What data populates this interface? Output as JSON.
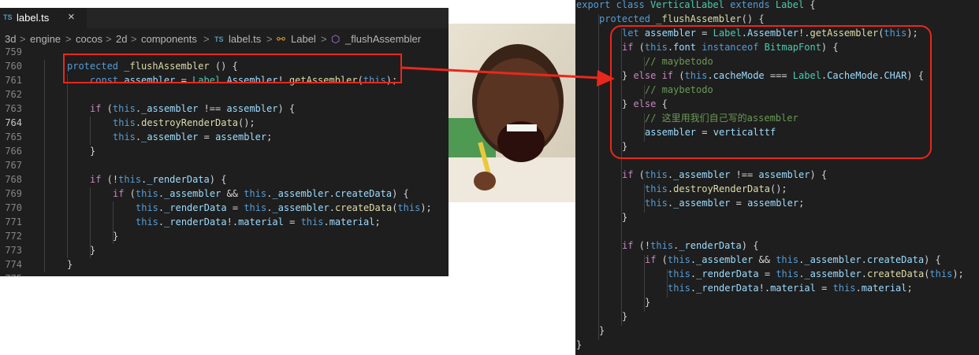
{
  "left_editor": {
    "tab": {
      "lang": "TS",
      "title": "label.ts",
      "close": "×"
    },
    "breadcrumb": {
      "items": [
        "3d",
        "engine",
        "cocos",
        "2d",
        "components"
      ],
      "file_lang": "TS",
      "file": "label.ts",
      "class_name": "Label",
      "method_name": "_flushAssembler",
      "separator": ">"
    },
    "lines": [
      {
        "n": "759",
        "tokens": []
      },
      {
        "n": "760",
        "tokens": [
          [
            "kw",
            "protected"
          ],
          [
            "txt",
            " "
          ],
          [
            "fn",
            "_flushAssembler"
          ],
          [
            "txt",
            " () {"
          ]
        ]
      },
      {
        "n": "761",
        "tokens": [
          [
            "kw",
            "const"
          ],
          [
            "txt",
            " "
          ],
          [
            "var",
            "assembler"
          ],
          [
            "txt",
            " = "
          ],
          [
            "cls",
            "Label"
          ],
          [
            "txt",
            "."
          ],
          [
            "var",
            "Assembler"
          ],
          [
            "txt",
            "!."
          ],
          [
            "fn",
            "getAssembler"
          ],
          [
            "txt",
            "("
          ],
          [
            "kw",
            "this"
          ],
          [
            "txt",
            ");"
          ]
        ]
      },
      {
        "n": "762",
        "tokens": []
      },
      {
        "n": "763",
        "tokens": [
          [
            "ctl",
            "if"
          ],
          [
            "txt",
            " ("
          ],
          [
            "kw",
            "this"
          ],
          [
            "txt",
            "."
          ],
          [
            "var",
            "_assembler"
          ],
          [
            "txt",
            " !== "
          ],
          [
            "var",
            "assembler"
          ],
          [
            "txt",
            ") {"
          ]
        ]
      },
      {
        "n": "764",
        "tokens": [
          [
            "kw",
            "this"
          ],
          [
            "txt",
            "."
          ],
          [
            "fn",
            "destroyRenderData"
          ],
          [
            "txt",
            "();"
          ]
        ]
      },
      {
        "n": "765",
        "tokens": [
          [
            "kw",
            "this"
          ],
          [
            "txt",
            "."
          ],
          [
            "var",
            "_assembler"
          ],
          [
            "txt",
            " = "
          ],
          [
            "var",
            "assembler"
          ],
          [
            "txt",
            ";"
          ]
        ]
      },
      {
        "n": "766",
        "tokens": [
          [
            "txt",
            "}"
          ]
        ]
      },
      {
        "n": "767",
        "tokens": []
      },
      {
        "n": "768",
        "tokens": [
          [
            "ctl",
            "if"
          ],
          [
            "txt",
            " (!"
          ],
          [
            "kw",
            "this"
          ],
          [
            "txt",
            "."
          ],
          [
            "var",
            "_renderData"
          ],
          [
            "txt",
            ") {"
          ]
        ]
      },
      {
        "n": "769",
        "tokens": [
          [
            "ctl",
            "if"
          ],
          [
            "txt",
            " ("
          ],
          [
            "kw",
            "this"
          ],
          [
            "txt",
            "."
          ],
          [
            "var",
            "_assembler"
          ],
          [
            "txt",
            " && "
          ],
          [
            "kw",
            "this"
          ],
          [
            "txt",
            "."
          ],
          [
            "var",
            "_assembler"
          ],
          [
            "txt",
            "."
          ],
          [
            "var",
            "createData"
          ],
          [
            "txt",
            ") {"
          ]
        ]
      },
      {
        "n": "770",
        "tokens": [
          [
            "kw",
            "this"
          ],
          [
            "txt",
            "."
          ],
          [
            "var",
            "_renderData"
          ],
          [
            "txt",
            " = "
          ],
          [
            "kw",
            "this"
          ],
          [
            "txt",
            "."
          ],
          [
            "var",
            "_assembler"
          ],
          [
            "txt",
            "."
          ],
          [
            "fn",
            "createData"
          ],
          [
            "txt",
            "("
          ],
          [
            "kw",
            "this"
          ],
          [
            "txt",
            ");"
          ]
        ]
      },
      {
        "n": "771",
        "tokens": [
          [
            "kw",
            "this"
          ],
          [
            "txt",
            "."
          ],
          [
            "var",
            "_renderData"
          ],
          [
            "txt",
            "!."
          ],
          [
            "var",
            "material"
          ],
          [
            "txt",
            " = "
          ],
          [
            "kw",
            "this"
          ],
          [
            "txt",
            "."
          ],
          [
            "var",
            "material"
          ],
          [
            "txt",
            ";"
          ]
        ]
      },
      {
        "n": "772",
        "tokens": [
          [
            "txt",
            "}"
          ]
        ]
      },
      {
        "n": "773",
        "tokens": [
          [
            "txt",
            "}"
          ]
        ]
      },
      {
        "n": "774",
        "tokens": [
          [
            "txt",
            "}"
          ]
        ]
      },
      {
        "n": "775",
        "tokens": []
      }
    ],
    "active_line": "764"
  },
  "right_editor": {
    "lines": [
      [
        [
          "kw",
          "export"
        ],
        [
          "txt",
          " "
        ],
        [
          "kw",
          "class"
        ],
        [
          "txt",
          " "
        ],
        [
          "cls",
          "VerticalLabel"
        ],
        [
          "txt",
          " "
        ],
        [
          "kw",
          "extends"
        ],
        [
          "txt",
          " "
        ],
        [
          "cls",
          "Label"
        ],
        [
          "txt",
          " {"
        ]
      ],
      [
        [
          "kw",
          "protected"
        ],
        [
          "txt",
          " "
        ],
        [
          "fn",
          "_flushAssembler"
        ],
        [
          "txt",
          "() {"
        ]
      ],
      [
        [
          "kw",
          "let"
        ],
        [
          "txt",
          " "
        ],
        [
          "var",
          "assembler"
        ],
        [
          "txt",
          " = "
        ],
        [
          "cls",
          "Label"
        ],
        [
          "txt",
          "."
        ],
        [
          "var",
          "Assembler"
        ],
        [
          "txt",
          "!."
        ],
        [
          "fn",
          "getAssembler"
        ],
        [
          "txt",
          "("
        ],
        [
          "kw",
          "this"
        ],
        [
          "txt",
          ");"
        ]
      ],
      [
        [
          "ctl",
          "if"
        ],
        [
          "txt",
          " ("
        ],
        [
          "kw",
          "this"
        ],
        [
          "txt",
          "."
        ],
        [
          "var",
          "font"
        ],
        [
          "txt",
          " "
        ],
        [
          "kw",
          "instanceof"
        ],
        [
          "txt",
          " "
        ],
        [
          "cls",
          "BitmapFont"
        ],
        [
          "txt",
          ") {"
        ]
      ],
      [
        [
          "cmt",
          "// maybetodo"
        ]
      ],
      [
        [
          "txt",
          "} "
        ],
        [
          "ctl",
          "else if"
        ],
        [
          "txt",
          " ("
        ],
        [
          "kw",
          "this"
        ],
        [
          "txt",
          "."
        ],
        [
          "var",
          "cacheMode"
        ],
        [
          "txt",
          " === "
        ],
        [
          "cls",
          "Label"
        ],
        [
          "txt",
          "."
        ],
        [
          "var",
          "CacheMode"
        ],
        [
          "txt",
          "."
        ],
        [
          "var",
          "CHAR"
        ],
        [
          "txt",
          ") {"
        ]
      ],
      [
        [
          "cmt",
          "// maybetodo"
        ]
      ],
      [
        [
          "txt",
          "} "
        ],
        [
          "ctl",
          "else"
        ],
        [
          "txt",
          " {"
        ]
      ],
      [
        [
          "cmt",
          "// 这里用我们自己写的assembler"
        ]
      ],
      [
        [
          "var",
          "assembler"
        ],
        [
          "txt",
          " = "
        ],
        [
          "var",
          "verticalttf"
        ]
      ],
      [
        [
          "txt",
          "}"
        ]
      ],
      [],
      [
        [
          "ctl",
          "if"
        ],
        [
          "txt",
          " ("
        ],
        [
          "kw",
          "this"
        ],
        [
          "txt",
          "."
        ],
        [
          "var",
          "_assembler"
        ],
        [
          "txt",
          " !== "
        ],
        [
          "var",
          "assembler"
        ],
        [
          "txt",
          ") {"
        ]
      ],
      [
        [
          "kw",
          "this"
        ],
        [
          "txt",
          "."
        ],
        [
          "fn",
          "destroyRenderData"
        ],
        [
          "txt",
          "();"
        ]
      ],
      [
        [
          "kw",
          "this"
        ],
        [
          "txt",
          "."
        ],
        [
          "var",
          "_assembler"
        ],
        [
          "txt",
          " = "
        ],
        [
          "var",
          "assembler"
        ],
        [
          "txt",
          ";"
        ]
      ],
      [
        [
          "txt",
          "}"
        ]
      ],
      [],
      [
        [
          "ctl",
          "if"
        ],
        [
          "txt",
          " (!"
        ],
        [
          "kw",
          "this"
        ],
        [
          "txt",
          "."
        ],
        [
          "var",
          "_renderData"
        ],
        [
          "txt",
          ") {"
        ]
      ],
      [
        [
          "ctl",
          "if"
        ],
        [
          "txt",
          " ("
        ],
        [
          "kw",
          "this"
        ],
        [
          "txt",
          "."
        ],
        [
          "var",
          "_assembler"
        ],
        [
          "txt",
          " && "
        ],
        [
          "kw",
          "this"
        ],
        [
          "txt",
          "."
        ],
        [
          "var",
          "_assembler"
        ],
        [
          "txt",
          "."
        ],
        [
          "var",
          "createData"
        ],
        [
          "txt",
          ") {"
        ]
      ],
      [
        [
          "kw",
          "this"
        ],
        [
          "txt",
          "."
        ],
        [
          "var",
          "_renderData"
        ],
        [
          "txt",
          " = "
        ],
        [
          "kw",
          "this"
        ],
        [
          "txt",
          "."
        ],
        [
          "var",
          "_assembler"
        ],
        [
          "txt",
          "."
        ],
        [
          "fn",
          "createData"
        ],
        [
          "txt",
          "("
        ],
        [
          "kw",
          "this"
        ],
        [
          "txt",
          ");"
        ]
      ],
      [
        [
          "kw",
          "this"
        ],
        [
          "txt",
          "."
        ],
        [
          "var",
          "_renderData"
        ],
        [
          "txt",
          "!."
        ],
        [
          "var",
          "material"
        ],
        [
          "txt",
          " = "
        ],
        [
          "kw",
          "this"
        ],
        [
          "txt",
          "."
        ],
        [
          "var",
          "material"
        ],
        [
          "txt",
          ";"
        ]
      ],
      [
        [
          "txt",
          "}"
        ]
      ],
      [
        [
          "txt",
          "}"
        ]
      ],
      [
        [
          "txt",
          "}"
        ]
      ],
      [
        [
          "txt",
          "}"
        ]
      ]
    ]
  },
  "colors": {
    "highlight": "#e8281c",
    "editor_bg": "#1e1e1e"
  }
}
